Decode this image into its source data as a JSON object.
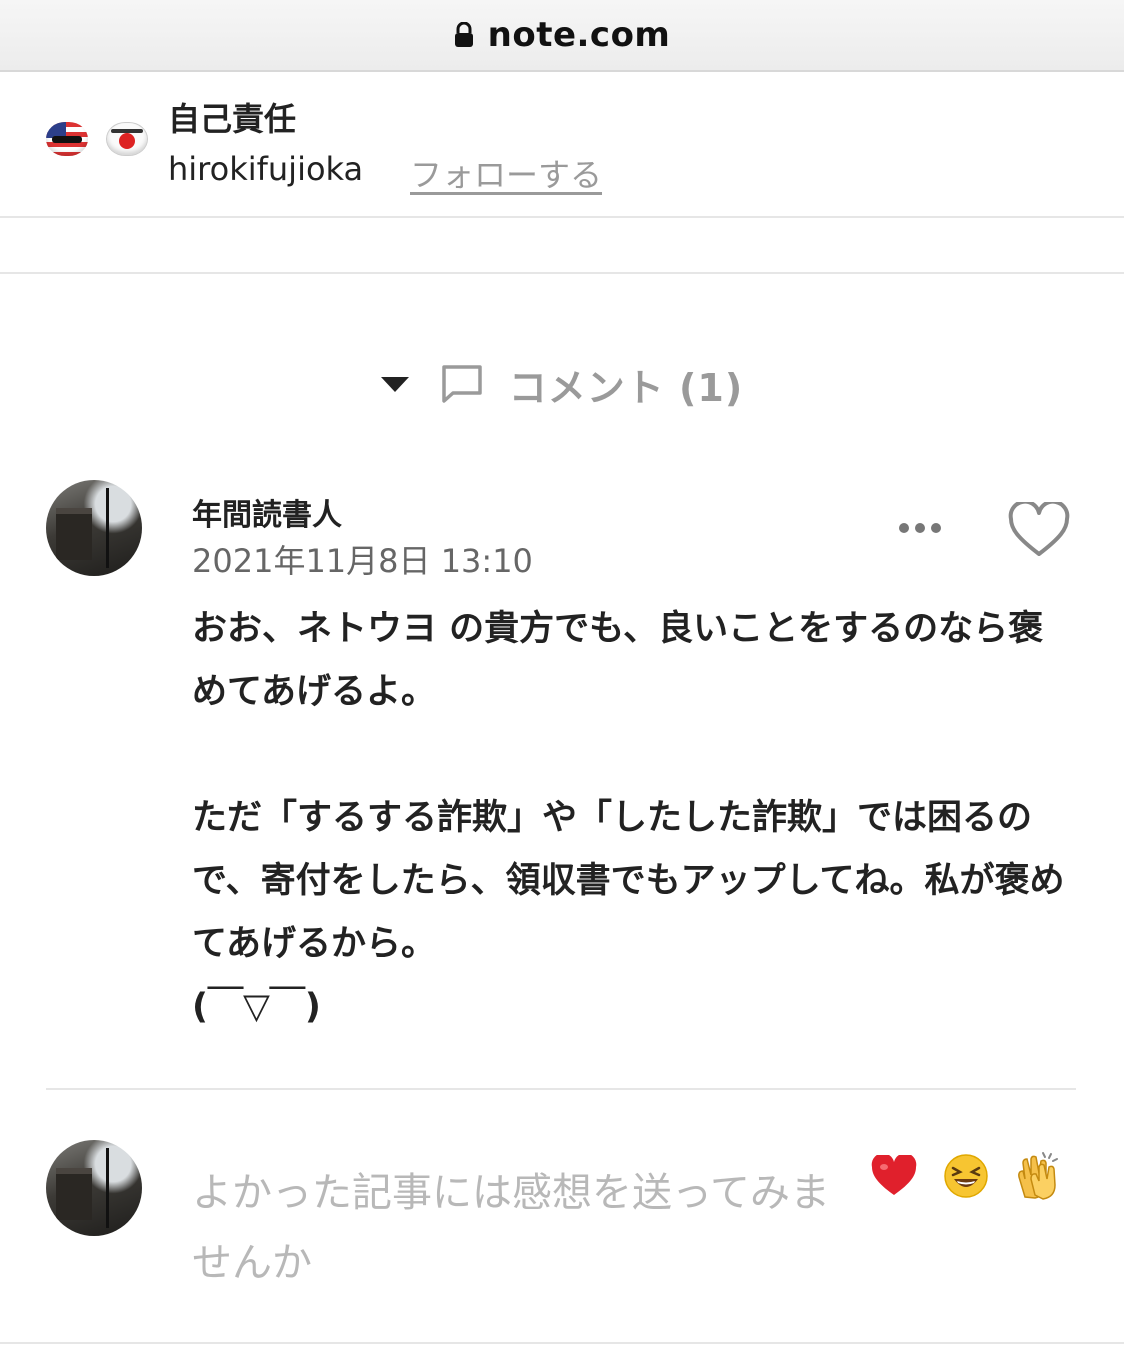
{
  "browser": {
    "url": "note.com",
    "lock_icon": "lock-icon"
  },
  "article": {
    "title": "自己責任",
    "author": "hirokifujioka",
    "follow_label": "フォローする",
    "author_icons": [
      "us-flag-ball-icon",
      "jp-flag-ball-icon"
    ]
  },
  "comments_section": {
    "toggle_icon": "triangle-down-icon",
    "comment_icon": "comment-bubble-icon",
    "label": "コメント (1)"
  },
  "comment": {
    "author": "年間読書人",
    "timestamp": "2021年11月8日 13:10",
    "paragraph1": "おお、ネトウヨ の貴方でも、良いことをするのなら褒めてあげるよ。",
    "paragraph2": "ただ「するする詐欺」や「したした詐欺」では困るので、寄付をしたら、領収書でもアップしてね。私が褒めてあげるから。",
    "kaomoji": "(￣▽￣)",
    "more_icon": "more-dots-icon",
    "like_icon": "heart-outline-icon"
  },
  "reply": {
    "placeholder": "よかった記事には感想を送ってみませんか",
    "emojis": [
      "❤️",
      "😆",
      "👏"
    ]
  },
  "colors": {
    "text": "#222222",
    "muted": "#9a9a9a",
    "placeholder": "#b8b8b8",
    "divider": "#e6e6e6"
  }
}
